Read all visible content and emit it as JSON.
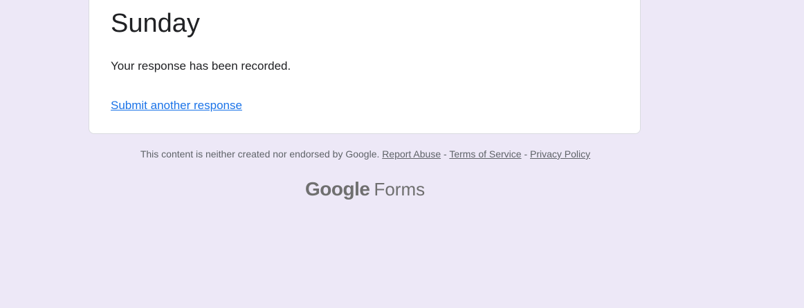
{
  "form": {
    "title": "Sunday",
    "confirmation_message": "Your response has been recorded.",
    "submit_another_label": "Submit another response"
  },
  "footer": {
    "disclaimer": "This content is neither created nor endorsed by Google.",
    "report_abuse": "Report Abuse",
    "separator1": " - ",
    "terms_of_service": "Terms of Service",
    "separator2": " - ",
    "privacy_policy": "Privacy Policy"
  },
  "branding": {
    "google": "Google",
    "forms": "Forms"
  },
  "colors": {
    "background": "#ede8f7",
    "link": "#1a73e8",
    "text": "#202124",
    "muted": "#5f6368"
  }
}
